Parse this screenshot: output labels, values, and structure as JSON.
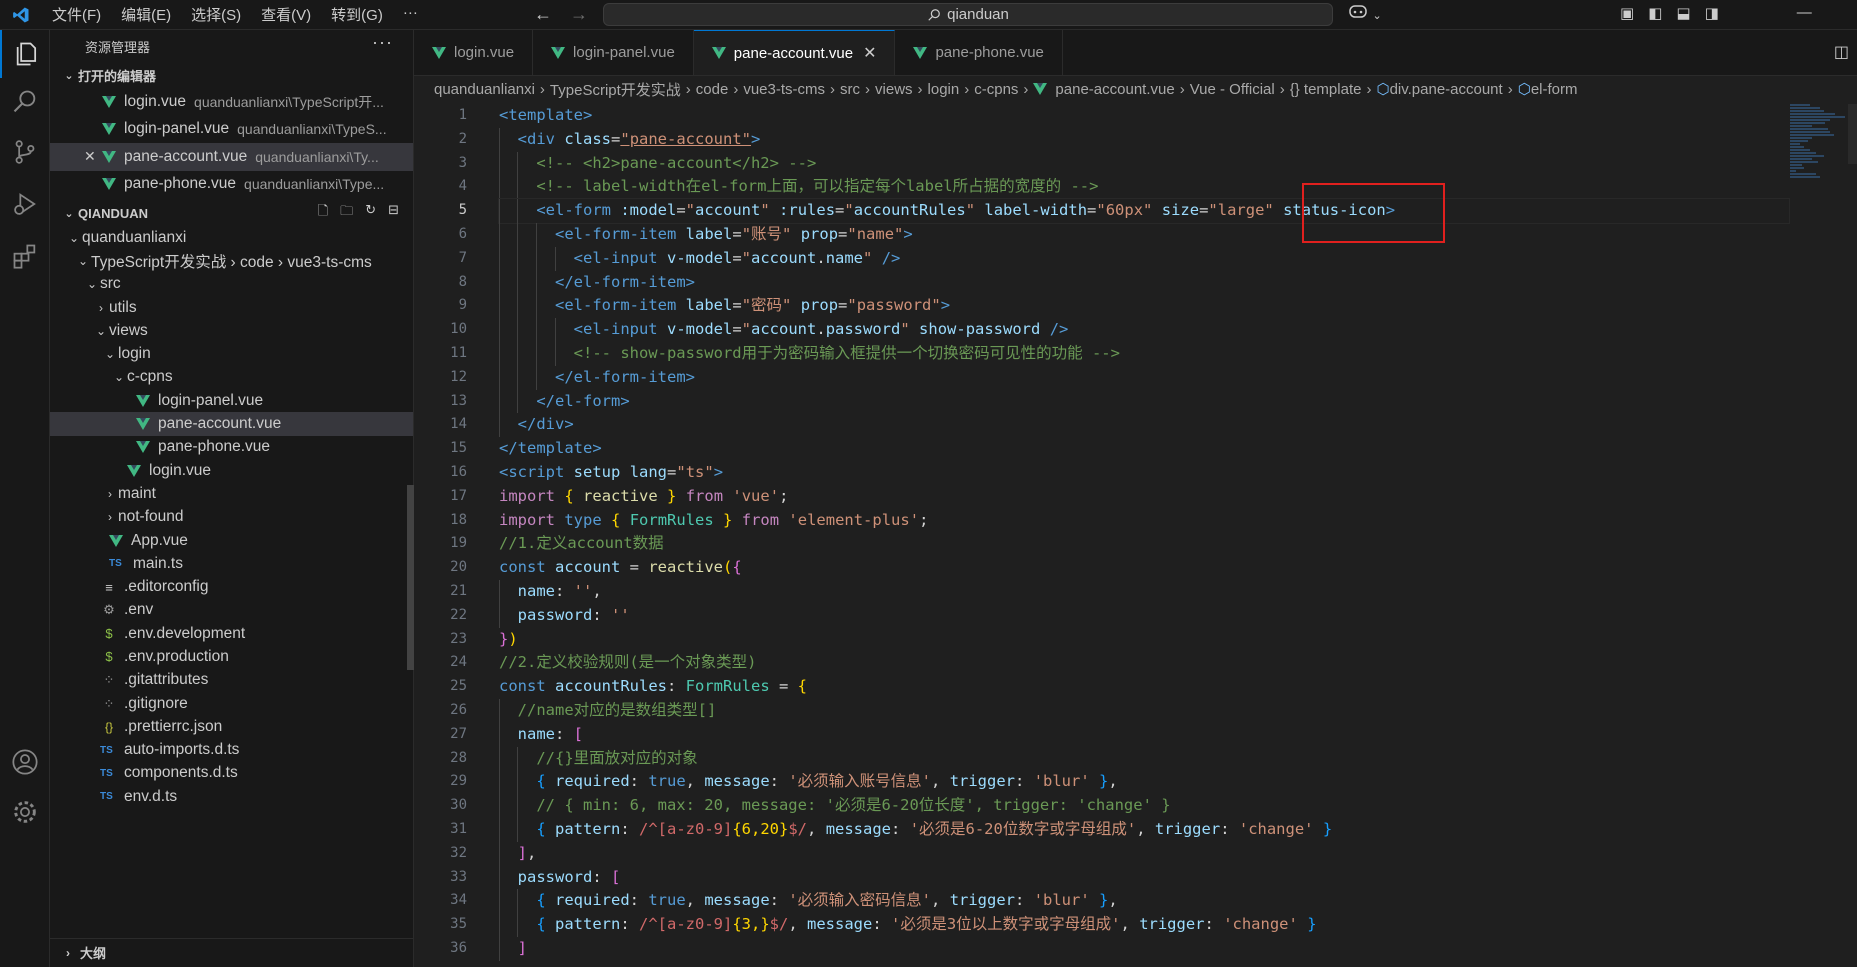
{
  "titlebar": {
    "menu": [
      "文件(F)",
      "编辑(E)",
      "选择(S)",
      "查看(V)",
      "转到(G)",
      "···"
    ],
    "search": "qianduan"
  },
  "sidebar": {
    "title": "资源管理器",
    "open_editors_label": "打开的编辑器",
    "open_editors": [
      {
        "name": "login.vue",
        "desc": "quanduanlianxi\\TypeScript开..."
      },
      {
        "name": "login-panel.vue",
        "desc": "quanduanlianxi\\TypeS..."
      },
      {
        "name": "pane-account.vue",
        "desc": "quanduanlianxi\\Ty...",
        "selected": true
      },
      {
        "name": "pane-phone.vue",
        "desc": "quanduanlianxi\\Type..."
      }
    ],
    "workspace_label": "QIANDUAN",
    "tree": [
      {
        "label": "quanduanlianxi",
        "indent": 0,
        "chev": "⌄",
        "icon": "none"
      },
      {
        "label": "TypeScript开发实战 › code › vue3-ts-cms",
        "indent": 1,
        "chev": "⌄",
        "icon": "none"
      },
      {
        "label": "src",
        "indent": 2,
        "chev": "⌄",
        "icon": "none"
      },
      {
        "label": "utils",
        "indent": 3,
        "chev": "›",
        "icon": "none"
      },
      {
        "label": "views",
        "indent": 3,
        "chev": "⌄",
        "icon": "none"
      },
      {
        "label": "login",
        "indent": 4,
        "chev": "⌄",
        "icon": "none"
      },
      {
        "label": "c-cpns",
        "indent": 5,
        "chev": "⌄",
        "icon": "none"
      },
      {
        "label": "login-panel.vue",
        "indent": 6,
        "chev": "",
        "icon": "vue"
      },
      {
        "label": "pane-account.vue",
        "indent": 6,
        "chev": "",
        "icon": "vue",
        "selected": true
      },
      {
        "label": "pane-phone.vue",
        "indent": 6,
        "chev": "",
        "icon": "vue"
      },
      {
        "label": "login.vue",
        "indent": 5,
        "chev": "",
        "icon": "vue"
      },
      {
        "label": "maint",
        "indent": 4,
        "chev": "›",
        "icon": "none"
      },
      {
        "label": "not-found",
        "indent": 4,
        "chev": "›",
        "icon": "none"
      },
      {
        "label": "App.vue",
        "indent": 3,
        "chev": "",
        "icon": "vue"
      },
      {
        "label": "main.ts",
        "indent": 3,
        "chev": "",
        "icon": "ts"
      },
      {
        "label": ".editorconfig",
        "indent": 2,
        "chev": "",
        "icon": "lines"
      },
      {
        "label": ".env",
        "indent": 2,
        "chev": "",
        "icon": "gear"
      },
      {
        "label": ".env.development",
        "indent": 2,
        "chev": "",
        "icon": "dollar"
      },
      {
        "label": ".env.production",
        "indent": 2,
        "chev": "",
        "icon": "dollar"
      },
      {
        "label": ".gitattributes",
        "indent": 2,
        "chev": "",
        "icon": "git"
      },
      {
        "label": ".gitignore",
        "indent": 2,
        "chev": "",
        "icon": "git"
      },
      {
        "label": ".prettierrc.json",
        "indent": 2,
        "chev": "",
        "icon": "json"
      },
      {
        "label": "auto-imports.d.ts",
        "indent": 2,
        "chev": "",
        "icon": "ts"
      },
      {
        "label": "components.d.ts",
        "indent": 2,
        "chev": "",
        "icon": "ts"
      },
      {
        "label": "env.d.ts",
        "indent": 2,
        "chev": "",
        "icon": "ts"
      }
    ],
    "outline_label": "大纲"
  },
  "tabs": [
    {
      "label": "login.vue",
      "active": false
    },
    {
      "label": "login-panel.vue",
      "active": false
    },
    {
      "label": "pane-account.vue",
      "active": true
    },
    {
      "label": "pane-phone.vue",
      "active": false
    }
  ],
  "breadcrumb": [
    "quanduanlianxi",
    "TypeScript开发实战",
    "code",
    "vue3-ts-cms",
    "src",
    "views",
    "login",
    "c-cpns",
    "pane-account.vue",
    "Vue - Official",
    "{} template",
    "div.pane-account",
    "el-form"
  ],
  "editor": {
    "current_line": 5,
    "line_numbers": [
      1,
      2,
      3,
      4,
      5,
      6,
      7,
      8,
      9,
      10,
      11,
      12,
      13,
      14,
      15,
      16,
      17,
      18,
      19,
      20,
      21,
      22,
      23,
      24,
      25,
      26,
      27,
      28,
      29,
      30,
      31,
      32,
      33,
      34,
      35,
      36
    ]
  }
}
